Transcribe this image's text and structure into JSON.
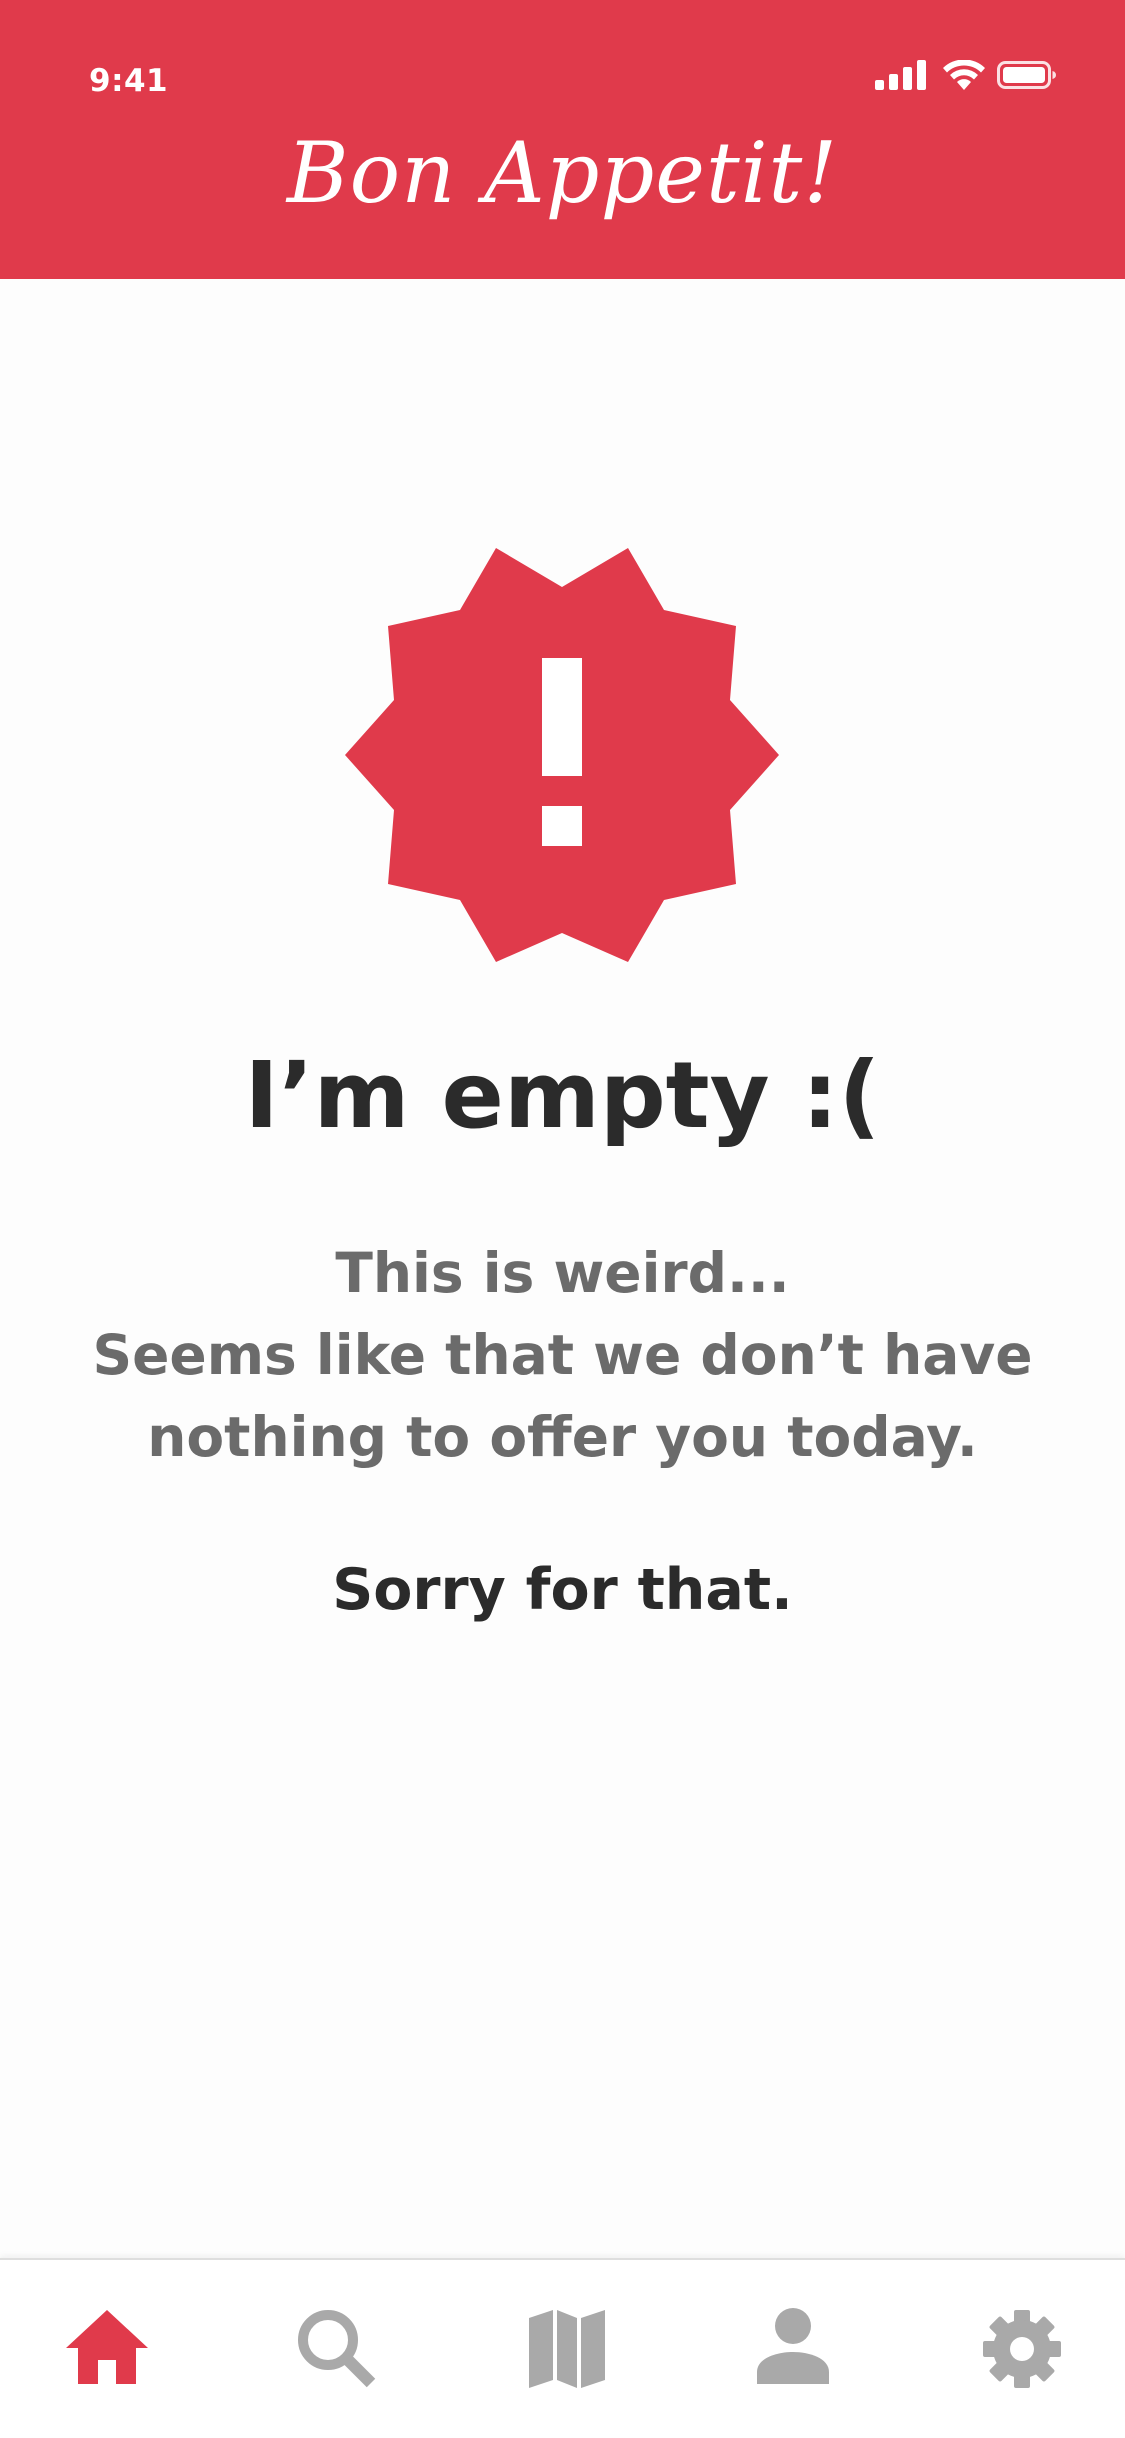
{
  "status_bar": {
    "time": "9:41",
    "icons": [
      "cellular-signal-icon",
      "wifi-icon",
      "battery-icon"
    ]
  },
  "header": {
    "title": "Bon Appetit!",
    "background_color": "#e03a4b"
  },
  "empty_state": {
    "icon": "alert-badge-icon",
    "title": "I’m empty :(",
    "message_lines": [
      "This is weird...",
      "Seems like that we don’t have",
      "nothing to offer you today."
    ],
    "closing": "Sorry for that."
  },
  "tab_bar": {
    "items": [
      {
        "icon": "home-icon",
        "active": true
      },
      {
        "icon": "search-icon",
        "active": false
      },
      {
        "icon": "map-icon",
        "active": false
      },
      {
        "icon": "user-icon",
        "active": false
      },
      {
        "icon": "settings-icon",
        "active": false
      }
    ],
    "active_color": "#e03a4b",
    "inactive_color": "#a9a9a9"
  }
}
